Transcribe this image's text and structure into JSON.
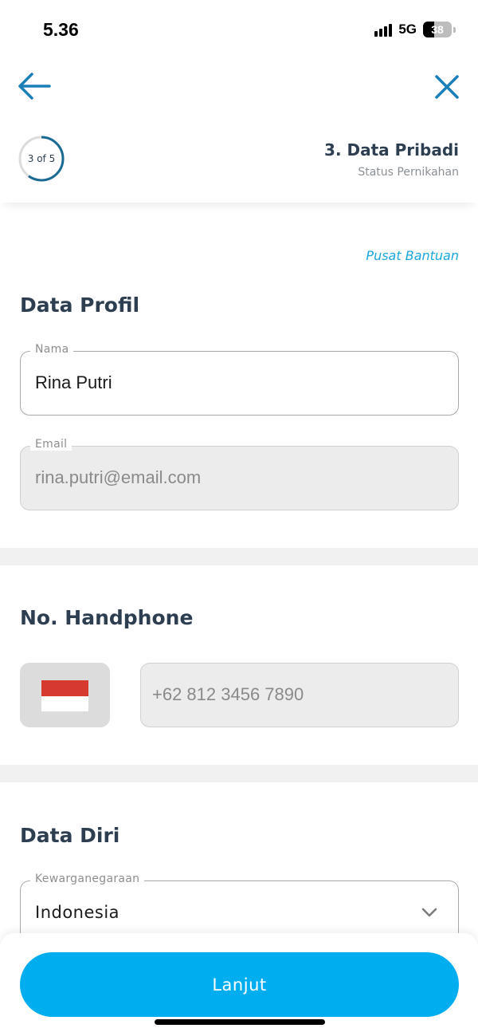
{
  "status_bar": {
    "time": "5.36",
    "network": "5G",
    "battery": "38",
    "battery_level": 0.38
  },
  "nav": {
    "back_icon": "arrow-left-icon",
    "close_icon": "close-icon",
    "accent_color": "#1a7fb8"
  },
  "step": {
    "indicator": "3 of 5",
    "current": 3,
    "total": 5,
    "title": "3. Data Pribadi",
    "subtitle": "Status Pernikahan"
  },
  "help_link": "Pusat Bantuan",
  "profile": {
    "title": "Data Profil",
    "name_label": "Nama",
    "name_value": "Rina Putri",
    "email_label": "Email",
    "email_value": "rina.putri@email.com"
  },
  "phone": {
    "title": "No. Handphone",
    "country_flag_icon": "indonesia-flag-icon",
    "value": "+62 812 3456 7890"
  },
  "personal": {
    "title": "Data Diri",
    "citizenship_label": "Kewarganegaraan",
    "citizenship_value": "Indonesia",
    "dropdown_icon": "chevron-down-icon"
  },
  "cta": {
    "label": "Lanjut",
    "color": "#00adef"
  }
}
